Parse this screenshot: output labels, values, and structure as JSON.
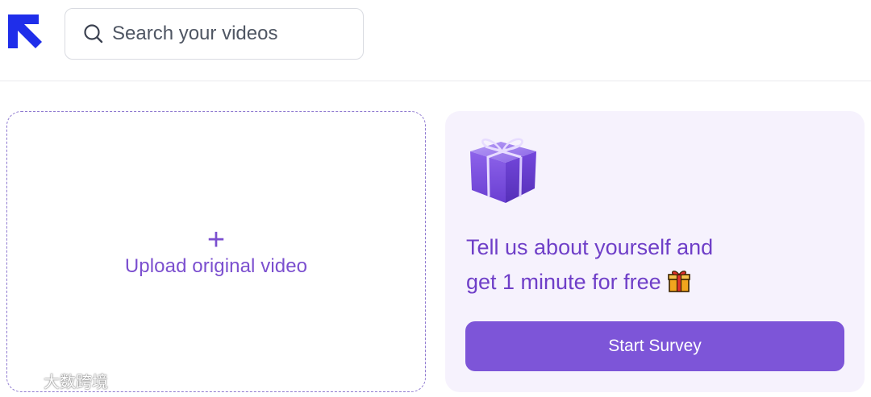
{
  "header": {
    "logo": "brand-arrow-icon",
    "search": {
      "placeholder": "Search your videos",
      "value": "",
      "icon": "search-icon"
    }
  },
  "upload": {
    "plus": "+",
    "label": "Upload original video"
  },
  "promo": {
    "image": "gift-box-image",
    "line1": "Tell us about yourself and",
    "line2": "get 1 minute for free",
    "emoji": "wrapped-gift-emoji",
    "button_label": "Start Survey"
  },
  "watermark": {
    "text": "大数跨境"
  },
  "colors": {
    "brand_blue": "#1f2eea",
    "accent_purple": "#7d55d8",
    "promo_text": "#6f3fc8",
    "promo_bg": "#f6f2fd"
  }
}
